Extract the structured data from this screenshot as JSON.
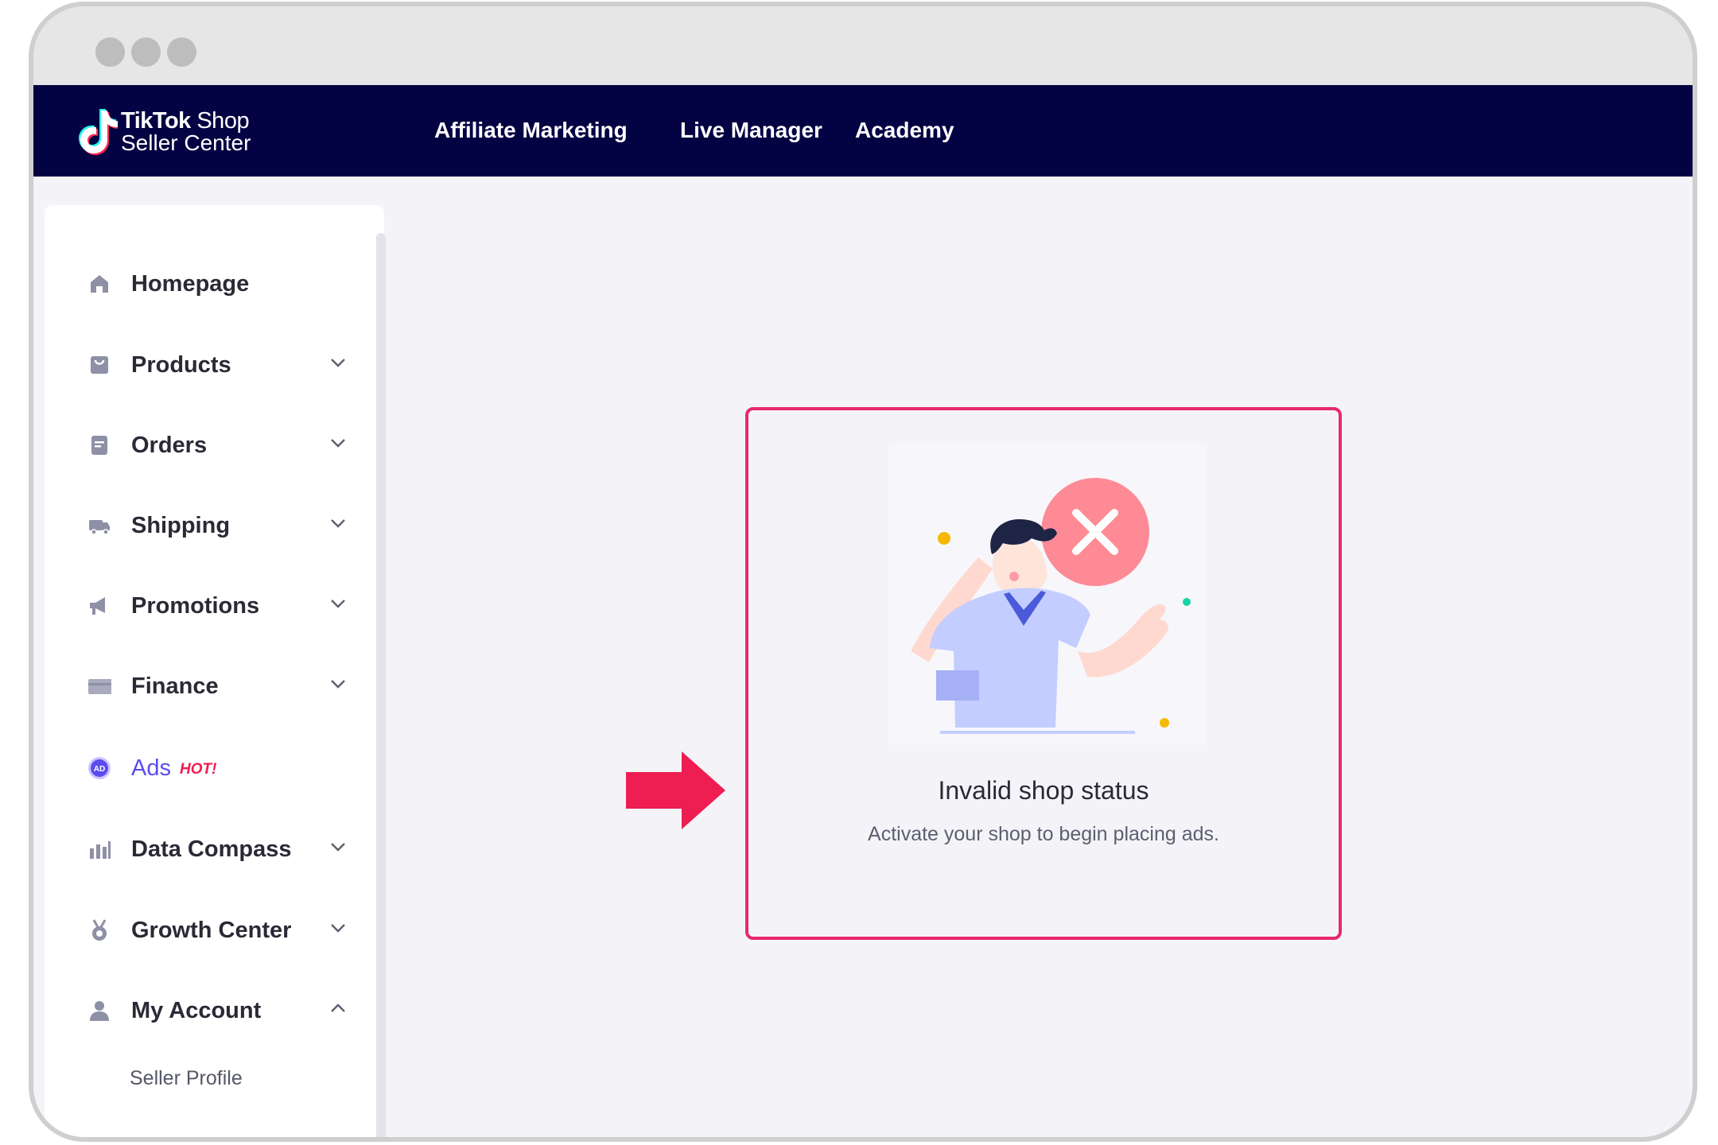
{
  "window": {
    "traffic_lights": [
      "close-dot",
      "minimize-dot",
      "maximize-dot"
    ]
  },
  "header": {
    "logo": {
      "brand": "TikTok",
      "product": "Shop",
      "subtitle": "Seller Center"
    },
    "nav": [
      {
        "label": "Affiliate Marketing"
      },
      {
        "label": "Live Manager"
      },
      {
        "label": "Academy"
      }
    ],
    "background_color": "#030242"
  },
  "sidebar": {
    "items": [
      {
        "label": "Homepage",
        "icon": "home-icon",
        "expandable": false
      },
      {
        "label": "Products",
        "icon": "bag-icon",
        "expandable": true,
        "expanded": false
      },
      {
        "label": "Orders",
        "icon": "document-icon",
        "expandable": true,
        "expanded": false
      },
      {
        "label": "Shipping",
        "icon": "truck-icon",
        "expandable": true,
        "expanded": false
      },
      {
        "label": "Promotions",
        "icon": "megaphone-icon",
        "expandable": true,
        "expanded": false
      },
      {
        "label": "Finance",
        "icon": "card-icon",
        "expandable": true,
        "expanded": false
      },
      {
        "label": "Ads",
        "icon": "ad-icon",
        "badge": "HOT!",
        "active": true,
        "expandable": false
      },
      {
        "label": "Data Compass",
        "icon": "bar-chart-icon",
        "expandable": true,
        "expanded": false
      },
      {
        "label": "Growth Center",
        "icon": "medal-icon",
        "expandable": true,
        "expanded": false
      },
      {
        "label": "My Account",
        "icon": "user-icon",
        "expandable": true,
        "expanded": true
      }
    ],
    "sub_items": [
      {
        "label": "Seller Profile"
      }
    ],
    "active_color": "#5b4cf0",
    "badge_color": "#ee1d52"
  },
  "main": {
    "empty_state": {
      "title": "Invalid shop status",
      "description": "Activate your shop to begin placing ads.",
      "illustration": "error-person-illustration"
    },
    "annotation": {
      "highlight_color": "#e8296b",
      "arrow_color": "#ee1d52"
    }
  }
}
